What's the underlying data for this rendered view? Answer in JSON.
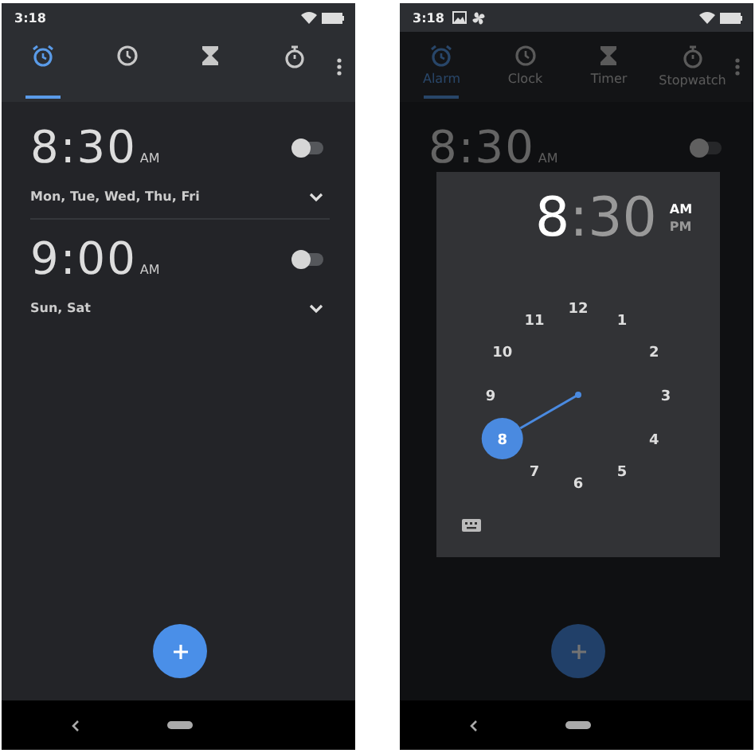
{
  "phones": [
    {
      "status_bar": {
        "time": "3:18",
        "notifications": false
      },
      "tabs": [
        {
          "selected": true
        },
        {
          "selected": false
        },
        {
          "selected": false
        },
        {
          "selected": false
        }
      ],
      "alarms": [
        {
          "time": "8:30",
          "period": "AM",
          "days": "Mon, Tue, Wed, Thu, Fri",
          "on": false
        },
        {
          "time": "9:00",
          "period": "AM",
          "days": "Sun, Sat",
          "on": false
        }
      ],
      "dimmed": false
    },
    {
      "status_bar": {
        "time": "3:18",
        "notifications": true
      },
      "tabs": [
        {
          "label": "Alarm",
          "selected": true
        },
        {
          "label": "Clock",
          "selected": false
        },
        {
          "label": "Timer",
          "selected": false
        },
        {
          "label": "Stopwatch",
          "selected": false
        }
      ],
      "alarms": [
        {
          "time": "8:30",
          "period": "AM",
          "on": false
        }
      ],
      "dimmed": true,
      "time_picker": {
        "hour": {
          "text": "8",
          "selected": true
        },
        "separator": ":",
        "minute": {
          "text": "30",
          "selected": false
        },
        "periods": [
          {
            "label": "AM",
            "selected": true
          },
          {
            "label": "PM",
            "selected": false
          }
        ],
        "dial": [
          {
            "label": "12",
            "selected": false
          },
          {
            "label": "1",
            "selected": false
          },
          {
            "label": "2",
            "selected": false
          },
          {
            "label": "3",
            "selected": false
          },
          {
            "label": "4",
            "selected": false
          },
          {
            "label": "5",
            "selected": false
          },
          {
            "label": "6",
            "selected": false
          },
          {
            "label": "7",
            "selected": false
          },
          {
            "label": "8",
            "selected": true
          },
          {
            "label": "9",
            "selected": false
          },
          {
            "label": "10",
            "selected": false
          },
          {
            "label": "11",
            "selected": false
          }
        ]
      }
    }
  ]
}
